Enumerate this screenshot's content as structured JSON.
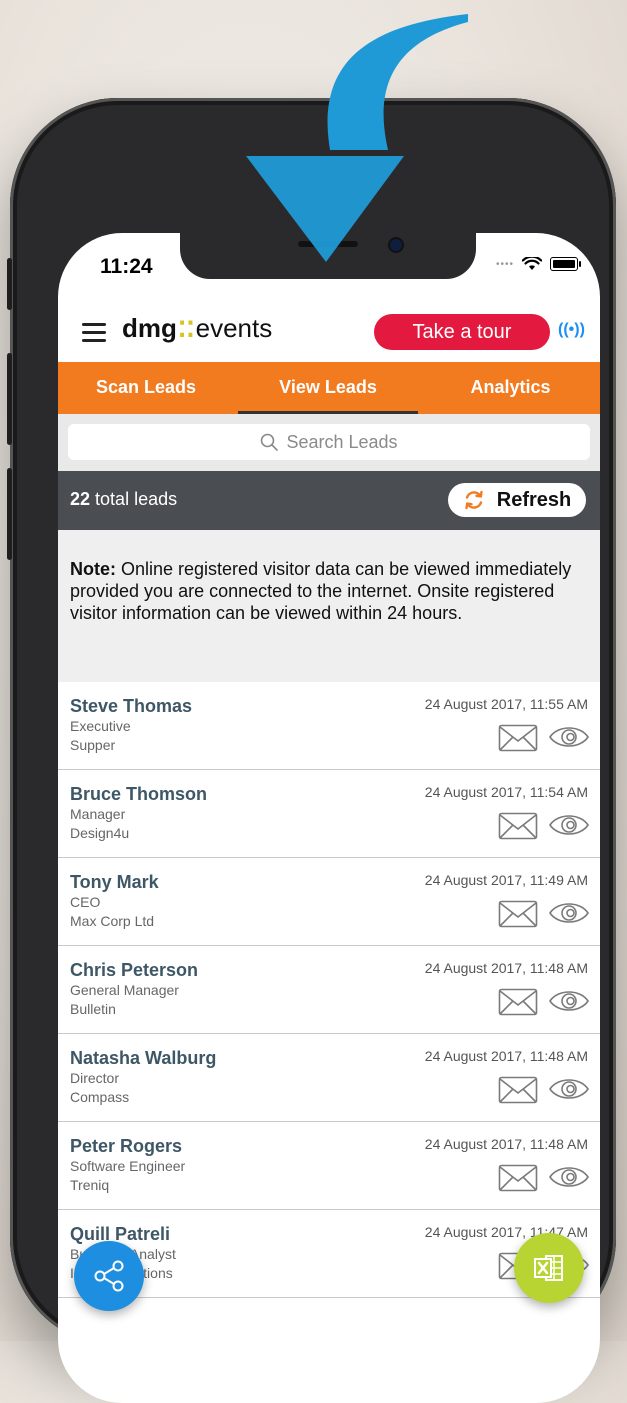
{
  "status_bar": {
    "time": "11:24"
  },
  "header": {
    "logo_bold": "dmg",
    "logo_light": "events",
    "tour_button": "Take a tour",
    "beacon": "((•))"
  },
  "tabs": [
    {
      "label": "Scan Leads"
    },
    {
      "label": "View Leads",
      "active": true
    },
    {
      "label": "Analytics"
    }
  ],
  "search": {
    "placeholder": "Search Leads"
  },
  "summary": {
    "count": "22",
    "count_suffix": "total leads",
    "refresh_label": "Refresh"
  },
  "note": {
    "label": "Note:",
    "text": " Online registered visitor data can be viewed immediately provided you are connected to the internet. Onsite registered visitor information can be viewed within 24 hours."
  },
  "leads": [
    {
      "name": "Steve Thomas",
      "title": "Executive",
      "company": "Supper",
      "date": "24 August 2017, 11:55 AM"
    },
    {
      "name": "Bruce Thomson",
      "title": "Manager",
      "company": "Design4u",
      "date": "24 August 2017, 11:54 AM"
    },
    {
      "name": "Tony Mark",
      "title": "CEO",
      "company": "Max Corp Ltd",
      "date": "24 August 2017, 11:49 AM"
    },
    {
      "name": "Chris Peterson",
      "title": "General Manager",
      "company": "Bulletin",
      "date": "24 August 2017, 11:48 AM"
    },
    {
      "name": "Natasha Walburg",
      "title": "Director",
      "company": "Compass",
      "date": "24 August 2017, 11:48 AM"
    },
    {
      "name": "Peter Rogers",
      "title": "Software Engineer",
      "company": "Treniq",
      "date": "24 August 2017, 11:48 AM"
    },
    {
      "name": "Quill Patreli",
      "title": "Business Analyst",
      "company": "Insight Solutions",
      "date": "24 August 2017, 11:47 AM"
    }
  ],
  "colors": {
    "brand_orange": "#f27a1f",
    "tour_red": "#e4193f",
    "share_blue": "#1d8ee0",
    "excel_green": "#b8d432",
    "arrow_blue": "#1f9ad6"
  },
  "icons": [
    "menu-icon",
    "search-icon",
    "refresh-icon",
    "mail-icon",
    "eye-icon",
    "share-icon",
    "excel-icon",
    "wifi-icon",
    "battery-icon"
  ]
}
